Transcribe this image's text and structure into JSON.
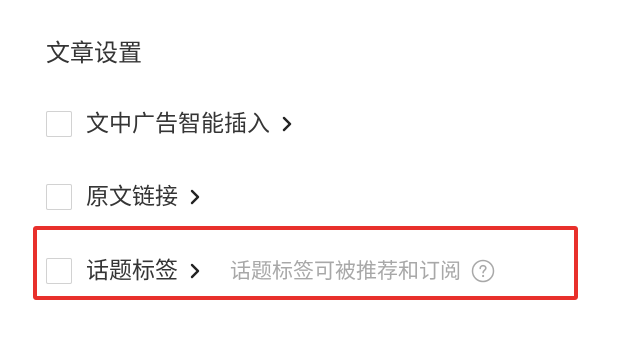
{
  "settings": {
    "title": "文章设置",
    "options": [
      {
        "label": "文中广告智能插入",
        "checked": false
      },
      {
        "label": "原文链接",
        "checked": false
      },
      {
        "label": "话题标签",
        "checked": false,
        "hint": "话题标签可被推荐和订阅"
      }
    ]
  },
  "colors": {
    "text": "#353535",
    "hint": "#a8a8a8",
    "checkbox_border": "#d2d2d2",
    "highlight": "#e8302b"
  },
  "icons": {
    "expand": "chevron-right-icon",
    "help": "question-circle-icon"
  }
}
